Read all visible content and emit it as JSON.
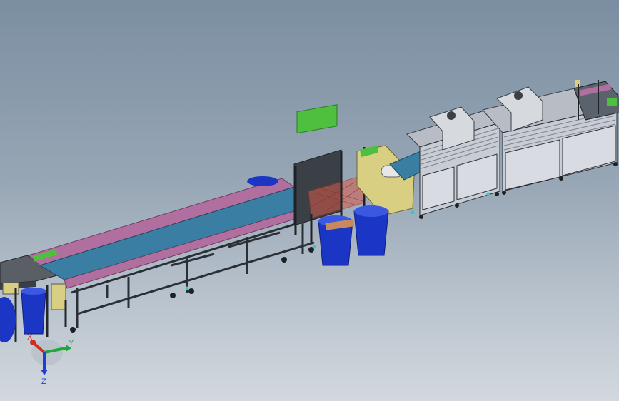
{
  "triad": {
    "x_label": "X",
    "y_label": "Y",
    "z_label": "Z",
    "x_color": "#d42a1f",
    "y_color": "#1fa83a",
    "z_color": "#1f3fd4"
  },
  "colors": {
    "belt": "#3a7fa3",
    "belt_side": "#b16fa0",
    "frame": "#2a2f36",
    "frame_light": "#5a626c",
    "panel": "#c8ccd4",
    "panel_dark": "#8b919a",
    "bin": "#1b36c4",
    "bin_rim": "#3b59e0",
    "hood": "#c0c4cc",
    "machine_yellow": "#d9cf83",
    "machine_green": "#4fbf3f",
    "net": "#d65a4c"
  }
}
